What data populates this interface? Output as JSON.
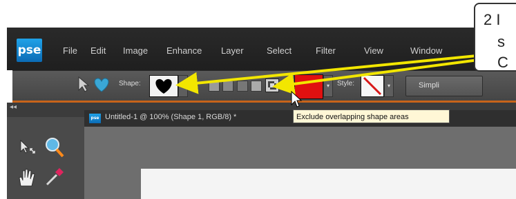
{
  "app": {
    "logo_text": "pse"
  },
  "menu": {
    "items": [
      "File",
      "Edit",
      "Image",
      "Enhance",
      "Layer",
      "Select",
      "Filter",
      "View",
      "Window"
    ]
  },
  "options_bar": {
    "shape_label": "Shape:",
    "style_label": "Style:",
    "simplify_label": "Simpli",
    "shape_icon": "heart-icon",
    "fill_color": "#e01010"
  },
  "document": {
    "tab_icon_text": "pse",
    "tab_title": "Untitled-1 @ 100% (Shape 1, RGB/8) *",
    "collapse_glyph": "◂◂"
  },
  "tooltip": {
    "text": "Exclude overlapping shape areas"
  },
  "callout": {
    "line1": "2 I",
    "line2": "s",
    "line3": "C"
  },
  "colors": {
    "accent_orange": "#c8641a",
    "arrow_yellow": "#f2e600",
    "menubar_bg": "#242424"
  }
}
